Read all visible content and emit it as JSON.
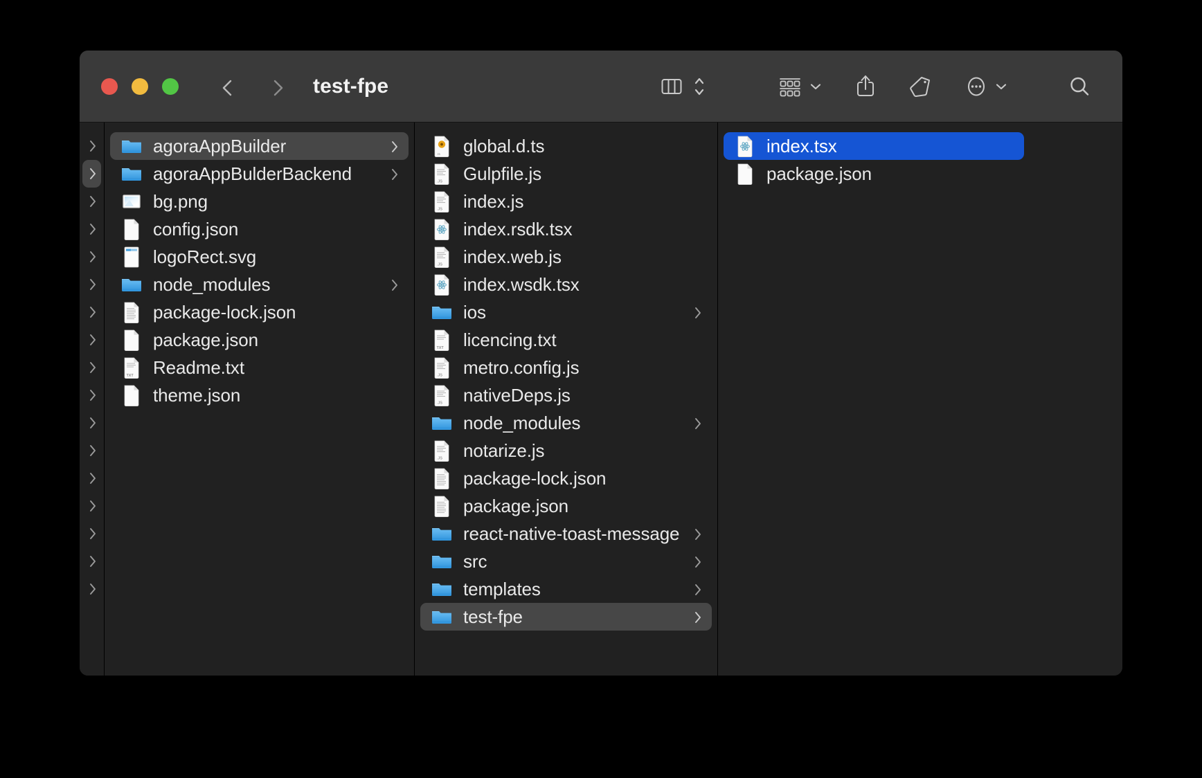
{
  "window": {
    "title": "test-fpe",
    "traffic_lights": [
      {
        "name": "close",
        "color": "#e8584f"
      },
      {
        "name": "minimize",
        "color": "#f2bb3f"
      },
      {
        "name": "maximize",
        "color": "#52c645"
      }
    ],
    "nav": {
      "back_icon": "chevron-left-icon",
      "forward_icon": "chevron-right-icon"
    },
    "toolbar_buttons": [
      {
        "name": "view-mode-column",
        "icon": "column-view-icon",
        "has_caret": false
      },
      {
        "name": "view-mode-stepper",
        "icon": "up-down-stepper-icon",
        "has_caret": false
      },
      {
        "name": "group-by",
        "icon": "group-grid-icon",
        "has_caret": true
      },
      {
        "name": "share",
        "icon": "share-icon",
        "has_caret": false
      },
      {
        "name": "tags",
        "icon": "tag-icon",
        "has_caret": false
      },
      {
        "name": "more-actions",
        "icon": "ellipsis-circle-icon",
        "has_caret": true
      },
      {
        "name": "search",
        "icon": "search-icon",
        "has_caret": false
      }
    ],
    "colors": {
      "toolbar_bg": "#3a3a3a",
      "content_bg": "#212121",
      "selection_active": "#1555d4",
      "selection_inactive": "#474747",
      "folder_blue": "#3ea3e8",
      "text": "#e9e9e9"
    }
  },
  "columns": [
    {
      "name": "column-ancestor-sliver",
      "items": [
        {
          "label": "",
          "kind": "folder",
          "chevron": true,
          "selected": false
        },
        {
          "label": "",
          "kind": "folder",
          "chevron": true,
          "selected": true
        },
        {
          "label": "",
          "kind": "folder",
          "chevron": true,
          "selected": false
        },
        {
          "label": "",
          "kind": "folder",
          "chevron": true,
          "selected": false
        },
        {
          "label": "",
          "kind": "folder",
          "chevron": true,
          "selected": false
        },
        {
          "label": "",
          "kind": "folder",
          "chevron": true,
          "selected": false
        },
        {
          "label": "",
          "kind": "folder",
          "chevron": true,
          "selected": false
        },
        {
          "label": "",
          "kind": "folder",
          "chevron": true,
          "selected": false
        },
        {
          "label": "",
          "kind": "folder",
          "chevron": true,
          "selected": false
        },
        {
          "label": "",
          "kind": "folder",
          "chevron": true,
          "selected": false
        },
        {
          "label": "",
          "kind": "folder",
          "chevron": true,
          "selected": false
        },
        {
          "label": "",
          "kind": "folder",
          "chevron": true,
          "selected": false
        },
        {
          "label": "",
          "kind": "folder",
          "chevron": true,
          "selected": false
        },
        {
          "label": "",
          "kind": "folder",
          "chevron": true,
          "selected": false
        },
        {
          "label": "",
          "kind": "folder",
          "chevron": true,
          "selected": false
        },
        {
          "label": "",
          "kind": "folder",
          "chevron": true,
          "selected": false
        },
        {
          "label": "",
          "kind": "folder",
          "chevron": true,
          "selected": false
        }
      ]
    },
    {
      "name": "column-agoraAppBuilder-parent",
      "items": [
        {
          "label": "agoraAppBuilder",
          "kind": "folder",
          "chevron": true,
          "selected": true
        },
        {
          "label": "agoraAppBulderBackend",
          "kind": "folder",
          "chevron": true,
          "selected": false
        },
        {
          "label": "bg.png",
          "kind": "image",
          "chevron": false,
          "selected": false
        },
        {
          "label": "config.json",
          "kind": "doc",
          "chevron": false,
          "selected": false
        },
        {
          "label": "logoRect.svg",
          "kind": "svg",
          "chevron": false,
          "selected": false
        },
        {
          "label": "node_modules",
          "kind": "folder",
          "chevron": true,
          "selected": false
        },
        {
          "label": "package-lock.json",
          "kind": "doc-text",
          "chevron": false,
          "selected": false
        },
        {
          "label": "package.json",
          "kind": "doc",
          "chevron": false,
          "selected": false
        },
        {
          "label": "Readme.txt",
          "kind": "txt",
          "chevron": false,
          "selected": false
        },
        {
          "label": "theme.json",
          "kind": "doc",
          "chevron": false,
          "selected": false
        }
      ]
    },
    {
      "name": "column-agoraAppBuilder-contents",
      "items": [
        {
          "label": "global.d.ts",
          "kind": "ts",
          "chevron": false,
          "selected": false
        },
        {
          "label": "Gulpfile.js",
          "kind": "js",
          "chevron": false,
          "selected": false
        },
        {
          "label": "index.js",
          "kind": "js",
          "chevron": false,
          "selected": false
        },
        {
          "label": "index.rsdk.tsx",
          "kind": "react",
          "chevron": false,
          "selected": false
        },
        {
          "label": "index.web.js",
          "kind": "js",
          "chevron": false,
          "selected": false
        },
        {
          "label": "index.wsdk.tsx",
          "kind": "react",
          "chevron": false,
          "selected": false
        },
        {
          "label": "ios",
          "kind": "folder",
          "chevron": true,
          "selected": false
        },
        {
          "label": "licencing.txt",
          "kind": "txt",
          "chevron": false,
          "selected": false
        },
        {
          "label": "metro.config.js",
          "kind": "js",
          "chevron": false,
          "selected": false
        },
        {
          "label": "nativeDeps.js",
          "kind": "js",
          "chevron": false,
          "selected": false
        },
        {
          "label": "node_modules",
          "kind": "folder",
          "chevron": true,
          "selected": false
        },
        {
          "label": "notarize.js",
          "kind": "js",
          "chevron": false,
          "selected": false
        },
        {
          "label": "package-lock.json",
          "kind": "doc-text",
          "chevron": false,
          "selected": false
        },
        {
          "label": "package.json",
          "kind": "doc-text",
          "chevron": false,
          "selected": false
        },
        {
          "label": "react-native-toast-message",
          "kind": "folder",
          "chevron": true,
          "selected": false
        },
        {
          "label": "src",
          "kind": "folder",
          "chevron": true,
          "selected": false
        },
        {
          "label": "templates",
          "kind": "folder",
          "chevron": true,
          "selected": false
        },
        {
          "label": "test-fpe",
          "kind": "folder",
          "chevron": true,
          "selected": true
        }
      ]
    },
    {
      "name": "column-test-fpe-contents",
      "items": [
        {
          "label": "index.tsx",
          "kind": "react",
          "chevron": false,
          "selected": true,
          "active": true
        },
        {
          "label": "package.json",
          "kind": "doc",
          "chevron": false,
          "selected": false
        }
      ]
    }
  ]
}
